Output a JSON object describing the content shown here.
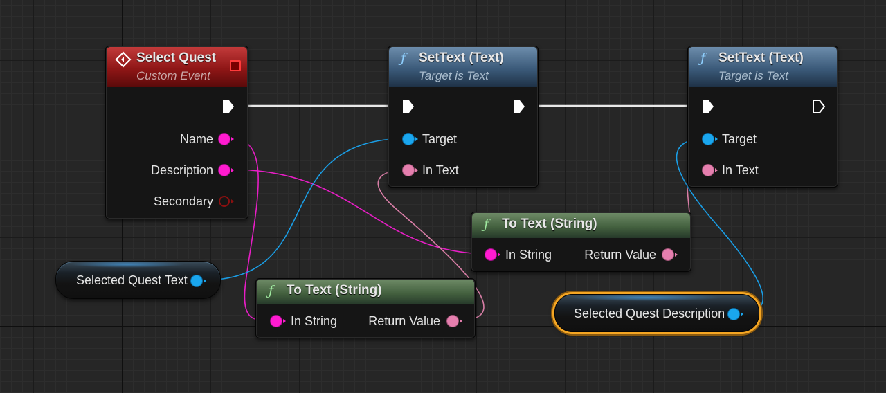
{
  "colors": {
    "event_header": "#8e1616",
    "function_header": "#3b5a79",
    "pure_header": "#44613f",
    "string_pin": "#ff1bd0",
    "text_pin": "#e57fae",
    "object_pin": "#1aa6ee",
    "selection": "#f5a623"
  },
  "nodes": {
    "select_quest": {
      "title": "Select Quest",
      "subtitle": "Custom Event",
      "icon": "event-diamond-icon",
      "outputs": [
        "Name",
        "Description",
        "Secondary"
      ]
    },
    "set_text_1": {
      "title": "SetText (Text)",
      "subtitle": "Target is Text",
      "icon": "function-icon",
      "inputs": [
        "Target",
        "In Text"
      ]
    },
    "set_text_2": {
      "title": "SetText (Text)",
      "subtitle": "Target is Text",
      "icon": "function-icon",
      "inputs": [
        "Target",
        "In Text"
      ]
    },
    "to_text_1": {
      "title": "To Text (String)",
      "icon": "function-icon",
      "input": "In String",
      "output": "Return Value"
    },
    "to_text_2": {
      "title": "To Text (String)",
      "icon": "function-icon",
      "input": "In String",
      "output": "Return Value"
    }
  },
  "variables": {
    "selected_quest_text": "Selected Quest Text",
    "selected_quest_description": "Selected Quest Description"
  }
}
